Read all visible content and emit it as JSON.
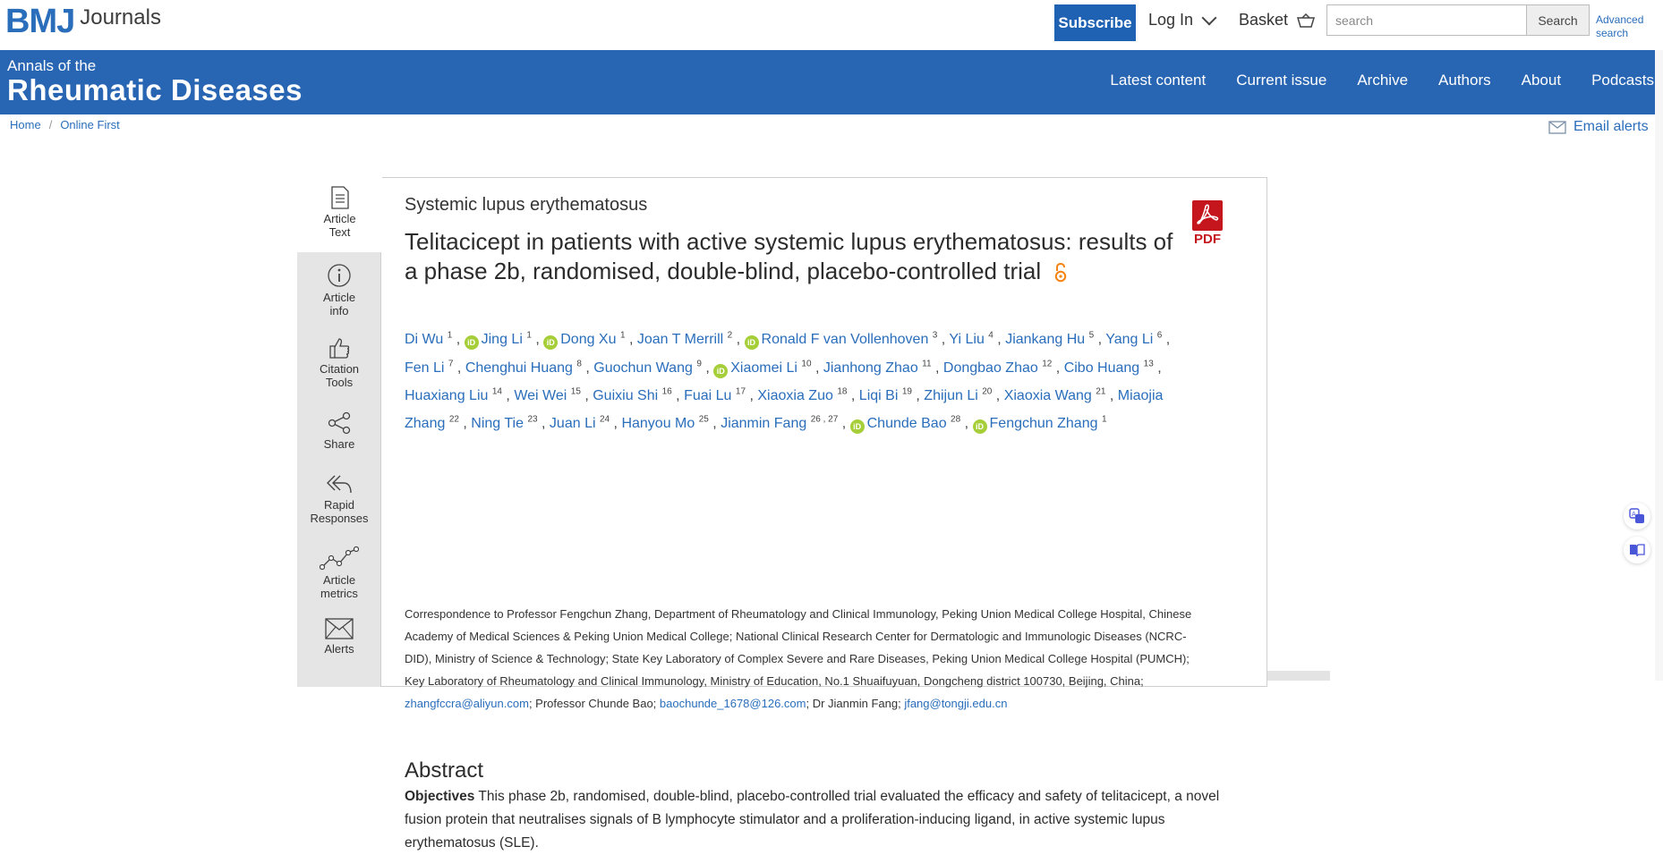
{
  "header": {
    "logo_main": "BMJ",
    "logo_sub": "Journals",
    "subscribe_label": "Subscribe",
    "login_label": "Log In",
    "basket_label": "Basket",
    "search_placeholder": "search",
    "search_button": "Search",
    "advanced_search": "Advanced search"
  },
  "banner": {
    "title_small": "Annals of the",
    "title_big": "Rheumatic Diseases",
    "nav": [
      "Latest content",
      "Current issue",
      "Archive",
      "Authors",
      "About",
      "Podcasts"
    ]
  },
  "breadcrumb": {
    "items": [
      "Home",
      "Online First"
    ],
    "separator": "/"
  },
  "email_alerts": "Email alerts",
  "sidetools": [
    {
      "label1": "Article",
      "label2": "Text",
      "icon": "document-icon"
    },
    {
      "label1": "Article",
      "label2": "info",
      "icon": "info-icon"
    },
    {
      "label1": "Citation",
      "label2": "Tools",
      "icon": "thumbs-up-icon"
    },
    {
      "label1": "Share",
      "label2": "",
      "icon": "share-icon"
    },
    {
      "label1": "Rapid",
      "label2": "Responses",
      "icon": "reply-icon"
    },
    {
      "label1": "Article",
      "label2": "metrics",
      "icon": "metrics-icon"
    },
    {
      "label1": "Alerts",
      "label2": "",
      "icon": "envelope-icon"
    }
  ],
  "article": {
    "category": "Systemic lupus erythematosus",
    "title": "Telitacicept in patients with active systemic lupus erythematosus: results of a phase 2b, randomised, double-blind, placebo-controlled trial",
    "pdf_label": "PDF",
    "orcid_badge": "iD",
    "authors": [
      {
        "name": "Di Wu",
        "sup": "1",
        "orcid": false
      },
      {
        "name": "Jing Li",
        "sup": "1",
        "orcid": true
      },
      {
        "name": "Dong Xu",
        "sup": "1",
        "orcid": true
      },
      {
        "name": "Joan T Merrill",
        "sup": "2",
        "orcid": false
      },
      {
        "name": "Ronald F van Vollenhoven",
        "sup": "3",
        "orcid": true
      },
      {
        "name": "Yi Liu",
        "sup": "4",
        "orcid": false
      },
      {
        "name": "Jiankang Hu",
        "sup": "5",
        "orcid": false
      },
      {
        "name": "Yang Li",
        "sup": "6",
        "orcid": false
      },
      {
        "name": "Fen Li",
        "sup": "7",
        "orcid": false
      },
      {
        "name": "Chenghui Huang",
        "sup": "8",
        "orcid": false
      },
      {
        "name": "Guochun Wang",
        "sup": "9",
        "orcid": false
      },
      {
        "name": "Xiaomei Li",
        "sup": "10",
        "orcid": true
      },
      {
        "name": "Jianhong Zhao",
        "sup": "11",
        "orcid": false
      },
      {
        "name": "Dongbao Zhao",
        "sup": "12",
        "orcid": false
      },
      {
        "name": "Cibo Huang",
        "sup": "13",
        "orcid": false
      },
      {
        "name": "Huaxiang Liu",
        "sup": "14",
        "orcid": false
      },
      {
        "name": "Wei Wei",
        "sup": "15",
        "orcid": false
      },
      {
        "name": "Guixiu Shi",
        "sup": "16",
        "orcid": false
      },
      {
        "name": "Fuai Lu",
        "sup": "17",
        "orcid": false
      },
      {
        "name": "Xiaoxia Zuo",
        "sup": "18",
        "orcid": false
      },
      {
        "name": "Liqi Bi",
        "sup": "19",
        "orcid": false
      },
      {
        "name": "Zhijun Li",
        "sup": "20",
        "orcid": false
      },
      {
        "name": "Xiaoxia Wang",
        "sup": "21",
        "orcid": false
      },
      {
        "name": "Miaojia Zhang",
        "sup": "22",
        "orcid": false
      },
      {
        "name": "Ning Tie",
        "sup": "23",
        "orcid": false
      },
      {
        "name": "Juan Li",
        "sup": "24",
        "orcid": false
      },
      {
        "name": "Hanyou Mo",
        "sup": "25",
        "orcid": false
      },
      {
        "name": "Jianmin Fang",
        "sup": "26 , 27",
        "orcid": false
      },
      {
        "name": "Chunde Bao",
        "sup": "28",
        "orcid": true
      },
      {
        "name": "Fengchun Zhang",
        "sup": "1",
        "orcid": true
      }
    ],
    "correspondence_text": "Correspondence to Professor Fengchun Zhang, Department of Rheumatology and Clinical Immunology, Peking Union Medical College Hospital, Chinese Academy of Medical Sciences & Peking Union Medical College; National Clinical Research Center for Dermatologic and Immunologic Diseases (NCRC-DID), Ministry of Science & Technology; State Key Laboratory of Complex Severe and Rare Diseases, Peking Union Medical College Hospital (PUMCH); Key Laboratory of Rheumatology and Clinical Immunology, Ministry of Education, No.1 Shuaifuyuan, Dongcheng district 100730, Beijing, China; ",
    "email1": "zhangfccra@aliyun.com",
    "mid_text": "; Professor Chunde Bao; ",
    "email2": "baochunde_1678@126.com",
    "mid_text2": "; Dr Jianmin Fang; ",
    "email3": "jfang@tongji.edu.cn",
    "abstract_heading": "Abstract",
    "objectives_label": "Objectives",
    "objectives_text": " This phase 2b, randomised, double-blind, placebo-controlled trial evaluated the efficacy and safety of telitacicept, a novel fusion protein that neutralises signals of B lymphocyte stimulator and a proliferation-inducing ligand, in active systemic lupus erythematosus (SLE)."
  },
  "colors": {
    "brand_blue": "#2865b3",
    "link_blue": "#2a6ebb",
    "orcid_green": "#a6ce39",
    "pdf_red": "#c4161c",
    "oa_orange": "#f68212"
  }
}
